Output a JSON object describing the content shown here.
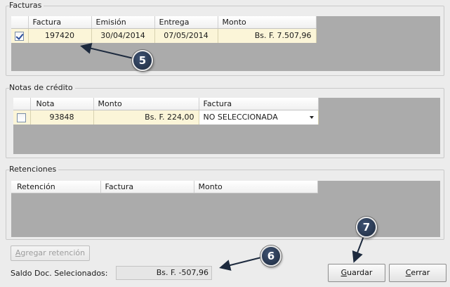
{
  "facturas": {
    "title": "Facturas",
    "columns": [
      "Factura",
      "Emisión",
      "Entrega",
      "Monto"
    ],
    "rows": [
      {
        "checked": true,
        "factura": "197420",
        "emision": "30/04/2014",
        "entrega": "07/05/2014",
        "monto": "Bs. F. 7.507,96"
      }
    ]
  },
  "notas": {
    "title": "Notas de crédito",
    "columns": [
      "Nota",
      "Monto",
      "Factura"
    ],
    "rows": [
      {
        "checked": false,
        "nota": "93848",
        "monto": "Bs. F. 224,00",
        "factura": "NO SELECCIONADA"
      }
    ]
  },
  "retenciones": {
    "title": "Retenciones",
    "columns": [
      "Retención",
      "Factura",
      "Monto"
    ]
  },
  "buttons": {
    "agregar_prefix": "",
    "agregar_mnemonic": "A",
    "agregar_rest": "gregar retención",
    "guardar_mnemonic": "G",
    "guardar_rest": "uardar",
    "cerrar_mnemonic": "C",
    "cerrar_rest": "errar"
  },
  "saldo": {
    "label": "Saldo Doc. Selecionados:",
    "value": "Bs. F. -507,96"
  },
  "annotations": {
    "badge_5": "5",
    "badge_6": "6",
    "badge_7": "7"
  },
  "colors": {
    "selected_row": "#fbf5d8",
    "grid_background": "#ababab",
    "badge": "#2a3a55"
  }
}
